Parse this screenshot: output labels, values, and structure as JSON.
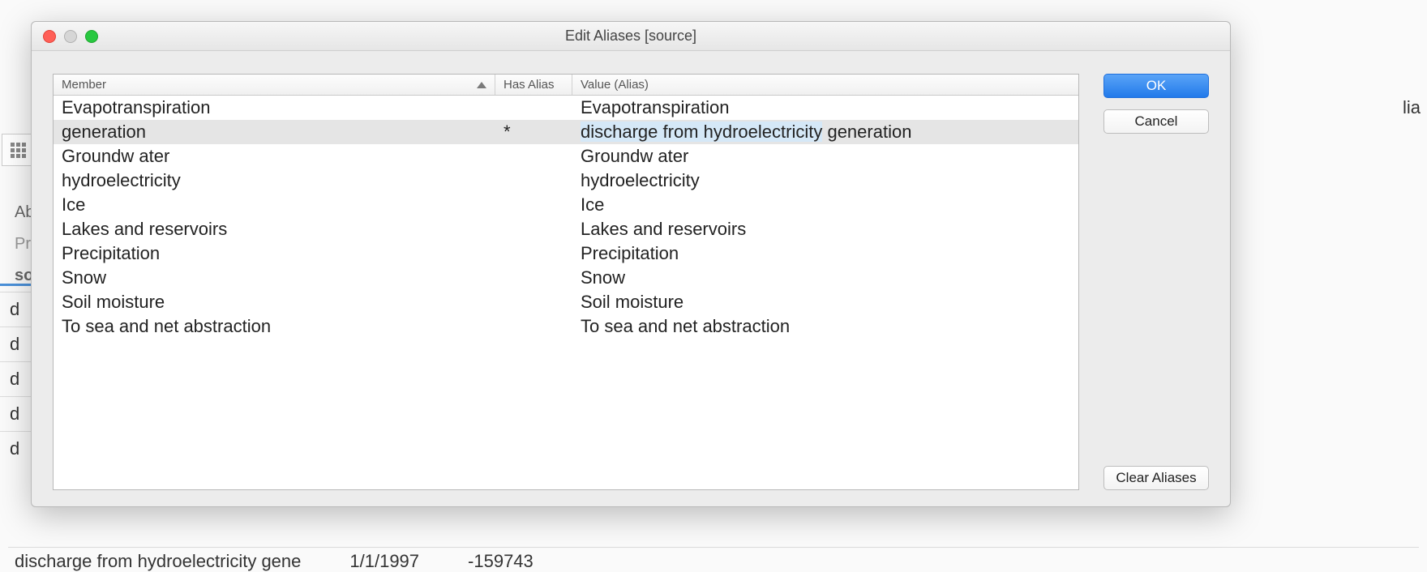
{
  "dialog": {
    "title": "Edit Aliases [source]",
    "columns": {
      "member": "Member",
      "has_alias": "Has Alias",
      "value": "Value (Alias)"
    },
    "rows": [
      {
        "member": "Evapotranspiration",
        "has_alias": "",
        "value": "Evapotranspiration",
        "selected": false
      },
      {
        "member": "generation",
        "has_alias": "*",
        "value_prefix": "discharge from hydroelectricity",
        "value_suffix": " generation",
        "selected": true
      },
      {
        "member": "Groundw ater",
        "has_alias": "",
        "value": "Groundw ater",
        "selected": false
      },
      {
        "member": "hydroelectricity",
        "has_alias": "",
        "value": "hydroelectricity",
        "selected": false
      },
      {
        "member": "Ice",
        "has_alias": "",
        "value": "Ice",
        "selected": false
      },
      {
        "member": "Lakes and reservoirs",
        "has_alias": "",
        "value": "Lakes and reservoirs",
        "selected": false
      },
      {
        "member": "Precipitation",
        "has_alias": "",
        "value": "Precipitation",
        "selected": false
      },
      {
        "member": "Snow",
        "has_alias": "",
        "value": "Snow",
        "selected": false
      },
      {
        "member": "Soil moisture",
        "has_alias": "",
        "value": "Soil moisture",
        "selected": false
      },
      {
        "member": "To sea and net abstraction",
        "has_alias": "",
        "value": "To sea and net abstraction",
        "selected": false
      }
    ],
    "buttons": {
      "ok": "OK",
      "cancel": "Cancel",
      "clear": "Clear Aliases"
    }
  },
  "background": {
    "right_fragment": "lia",
    "left_items": [
      "Ab",
      "Pr",
      "so"
    ],
    "left_rows": [
      "d",
      "d",
      "d",
      "d",
      "d"
    ],
    "bottom": {
      "text": "discharge from hydroelectricity gene",
      "date": "1/1/1997",
      "value": "-159743"
    }
  }
}
